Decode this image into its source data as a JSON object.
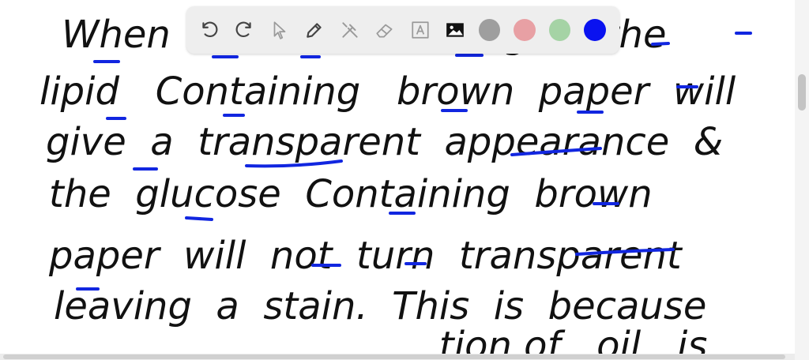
{
  "toolbar": {
    "tools": [
      {
        "name": "undo",
        "icon": "undo-icon",
        "enabled": true
      },
      {
        "name": "redo",
        "icon": "redo-icon",
        "enabled": true
      },
      {
        "name": "select",
        "icon": "cursor-icon",
        "enabled": false
      },
      {
        "name": "pen",
        "icon": "pen-icon",
        "enabled": true
      },
      {
        "name": "tools",
        "icon": "tools-icon",
        "enabled": false
      },
      {
        "name": "eraser",
        "icon": "eraser-icon",
        "enabled": false
      },
      {
        "name": "text",
        "icon": "text-box-icon",
        "enabled": false
      },
      {
        "name": "image",
        "icon": "image-icon",
        "enabled": true
      }
    ],
    "colors": [
      "#9e9e9e",
      "#e8a0a4",
      "#a5d3a5",
      "#0a12f0"
    ],
    "selected_color": "#0a12f0"
  },
  "notes": {
    "line0": "When                          light   the",
    "line1": "lipid   Containing   brown  paper  will",
    "line2": "give  a  transparent  appearance  &",
    "line3": "the  glucose  Containing  brown",
    "line4": "paper  will  not  turn  transparent",
    "line5": "leaving  a  stain.  This  is  because",
    "line6": "                       tion of   oil   is"
  }
}
